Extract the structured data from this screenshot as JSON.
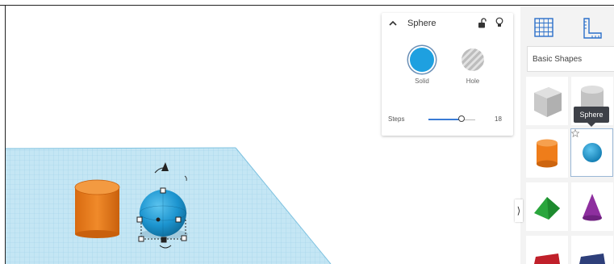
{
  "properties_panel": {
    "title": "Sphere",
    "solid_label": "Solid",
    "hole_label": "Hole",
    "steps_label": "Steps",
    "steps_value": "18",
    "steps_fraction": 0.7
  },
  "library": {
    "shape_set": "Basic Shapes",
    "tooltip": "Sphere"
  },
  "colors": {
    "solid": "#1ea0e0",
    "cylinder": "#ef7d1a",
    "pyramid": "#2aa63d",
    "cone": "#8e2f9f",
    "grid": "#bfe2f1"
  },
  "icons": {
    "collapse": "chevron-up-icon",
    "lock": "unlock-icon",
    "visibility": "lightbulb-icon",
    "workplane": "grid-icon",
    "ruler": "ruler-icon",
    "favorite": "star-icon",
    "panel_toggle": "chevron-right-icon"
  },
  "panel_toggle_glyph": "⟩"
}
